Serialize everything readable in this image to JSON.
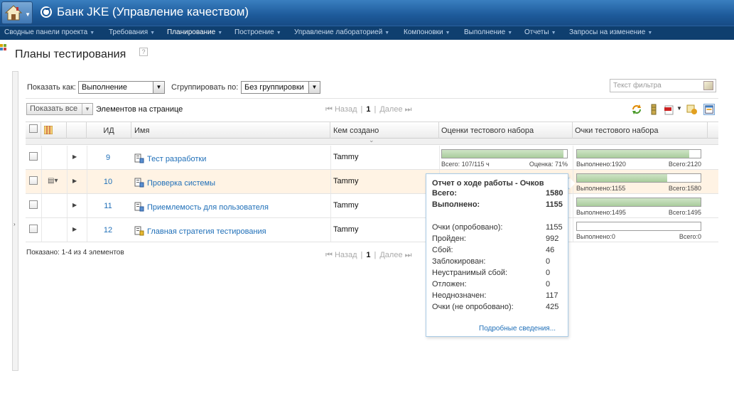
{
  "header": {
    "app_title": "Банк JKE (Управление качеством)"
  },
  "nav": [
    {
      "label": "Сводные панели проекта"
    },
    {
      "label": "Требования"
    },
    {
      "label": "Планирование"
    },
    {
      "label": "Построение"
    },
    {
      "label": "Управление лабораторией"
    },
    {
      "label": "Компоновки"
    },
    {
      "label": "Выполнение"
    },
    {
      "label": "Отчеты"
    },
    {
      "label": "Запросы на изменение"
    }
  ],
  "page": {
    "title": "Планы тестирования",
    "help": "?"
  },
  "controls": {
    "show_as_label": "Показать как:",
    "show_as_value": "Выполнение",
    "group_by_label": "Сгруппировать по:",
    "group_by_value": "Без группировки",
    "filter_placeholder": "Текст фильтра",
    "show_all": "Показать все",
    "items_per_page": "Элементов на странице"
  },
  "pager": {
    "prev": "Назад",
    "page": "1",
    "next": "Далее",
    "sep": "|"
  },
  "columns": {
    "id": "ИД",
    "name": "Имя",
    "created_by": "Кем создано",
    "suite_scores": "Оценки тестового набора",
    "suite_points": "Очки тестового набора"
  },
  "rows": [
    {
      "id": "9",
      "name": "Тест разработки",
      "owner": "Tammy",
      "score_fill": 0.97,
      "score_left": "Всего: 107/115 ч",
      "score_right": "Оценка: 71%",
      "points_fill": 0.91,
      "points_left": "Выполнено:1920",
      "points_right": "Всего:2120"
    },
    {
      "id": "10",
      "name": "Проверка системы",
      "owner": "Tammy",
      "points_fill": 0.73,
      "points_left": "Выполнено:1155",
      "points_right": "Всего:1580"
    },
    {
      "id": "11",
      "name": "Приемлемость для пользователя",
      "owner": "Tammy",
      "points_fill": 1.0,
      "points_left": "Выполнено:1495",
      "points_right": "Всего:1495"
    },
    {
      "id": "12",
      "name": "Главная стратегия тестирования",
      "owner": "Tammy",
      "points_fill": 0.0,
      "points_left": "Выполнено:0",
      "points_right": "Всего:0"
    }
  ],
  "footer": {
    "shown": "Показано: 1-4 из 4 элементов"
  },
  "popup": {
    "title": "Отчет о ходе работы - Очков",
    "total_label": "Всего:",
    "total_value": "1580",
    "done_label": "Выполнено:",
    "done_value": "1155",
    "stats": [
      {
        "label": "Очки (опробовано):",
        "value": "1155"
      },
      {
        "label": "Пройден:",
        "value": "992"
      },
      {
        "label": "Сбой:",
        "value": "46"
      },
      {
        "label": "Заблокирован:",
        "value": "0"
      },
      {
        "label": "Неустранимый сбой:",
        "value": "0"
      },
      {
        "label": "Отложен:",
        "value": "0"
      },
      {
        "label": "Неоднозначен:",
        "value": "117"
      },
      {
        "label": "Очки (не опробовано):",
        "value": "425"
      }
    ],
    "details_link": "Подробные сведения..."
  }
}
